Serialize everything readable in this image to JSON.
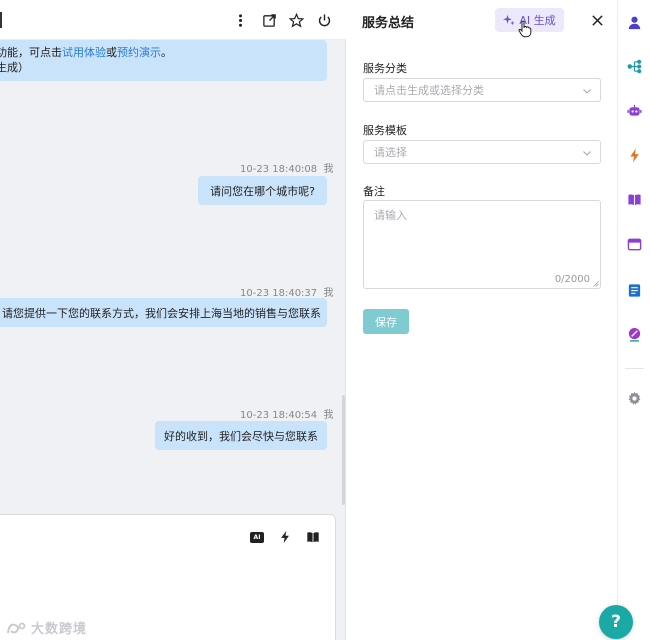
{
  "chat": {
    "partial_ai_message": {
      "line1_prefix": "功能，可点击",
      "link1": "试用体验",
      "mid": "或",
      "link2": "预约演示",
      "end": "。",
      "line2": "生成）"
    },
    "messages": [
      {
        "side": "me",
        "time": "10-23 18:40:08",
        "sender": "我",
        "text": "请问您在哪个城市呢?"
      },
      {
        "side": "me",
        "time": "10-23 18:40:37",
        "sender": "我",
        "text": "请您提供一下您的联系方式，我们会安排上海当地的销售与您联系"
      },
      {
        "side": "me",
        "time": "10-23 18:40:54",
        "sender": "我",
        "text": "好的收到，我们会尽快与您联系"
      }
    ],
    "input_tools": {
      "ai_chip": "AI"
    },
    "watermark": "大数跨境"
  },
  "panel": {
    "title": "服务总结",
    "ai_button": "AI 生成",
    "category": {
      "label": "服务分类",
      "placeholder": "请点击生成或选择分类"
    },
    "template": {
      "label": "服务模板",
      "placeholder": "请选择"
    },
    "notes": {
      "label": "备注",
      "placeholder": "请输入",
      "counter": "0/2000"
    },
    "save": "保存"
  },
  "rail": {
    "icons": [
      "user-icon",
      "org-tree-icon",
      "robot-icon",
      "lightning-icon",
      "book-icon",
      "window-icon",
      "document-icon",
      "compass-icon",
      "gear-icon"
    ]
  },
  "help": "?",
  "colors": {
    "bubble": "#c9e3fb",
    "accent_teal": "#1ba9a5",
    "save_button": "#7ecbd1",
    "ai_purple": "#6a4fd6"
  }
}
